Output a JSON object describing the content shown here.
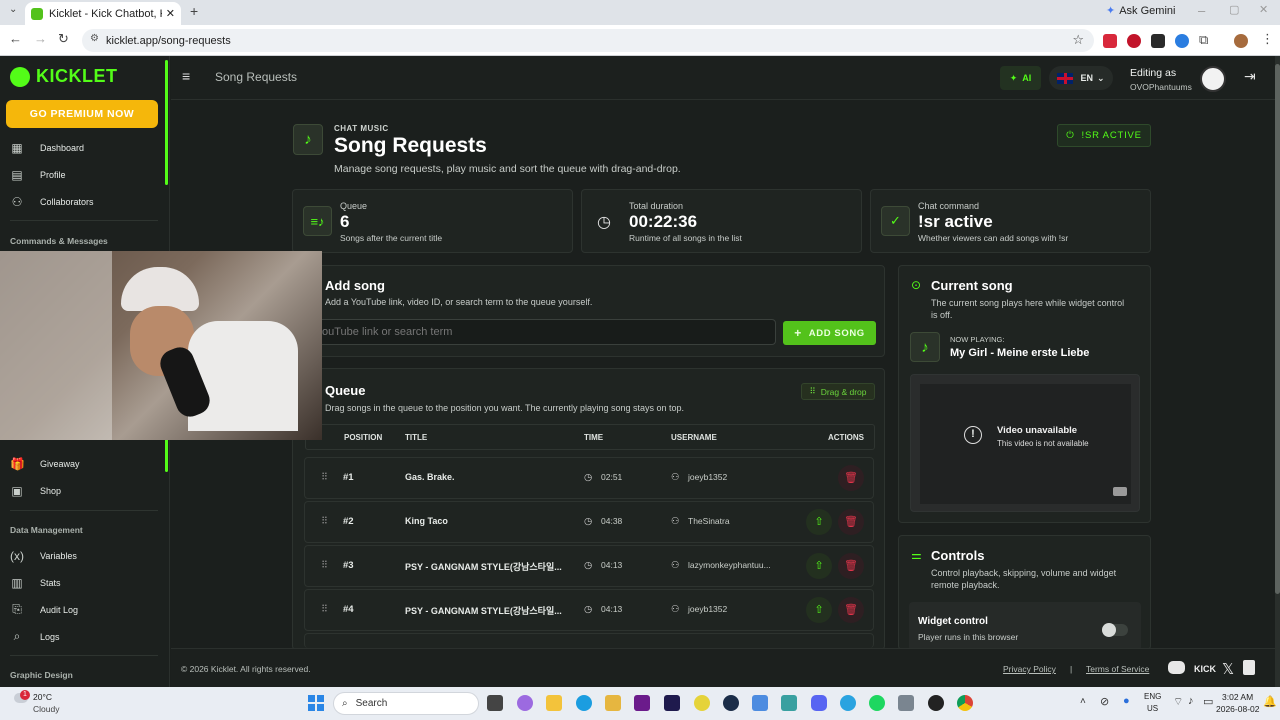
{
  "browser": {
    "tab_title": "Kicklet - Kick Chatbot, Kick Wid",
    "ask_gemini": "Ask Gemini",
    "url": "kicklet.app/song-requests"
  },
  "sidebar": {
    "logo": "KICKLET",
    "premium_button": "GO PREMIUM NOW",
    "items_top": [
      {
        "label": "Dashboard",
        "icon": "dashboard-icon"
      },
      {
        "label": "Profile",
        "icon": "profile-icon"
      },
      {
        "label": "Collaborators",
        "icon": "collaborators-icon"
      }
    ],
    "section_commands": "Commands & Messages",
    "items_mid": [
      {
        "label": "Giveaway",
        "icon": "giveaway-icon"
      },
      {
        "label": "Shop",
        "icon": "shop-icon"
      }
    ],
    "section_data": "Data Management",
    "items_data": [
      {
        "label": "Variables",
        "icon": "variables-icon"
      },
      {
        "label": "Stats",
        "icon": "stats-icon"
      },
      {
        "label": "Audit Log",
        "icon": "audit-log-icon"
      },
      {
        "label": "Logs",
        "icon": "logs-icon"
      }
    ],
    "section_graphic": "Graphic Design"
  },
  "topbar": {
    "title": "Song Requests",
    "ai_label": "AI",
    "lang": "EN",
    "editing_as": "Editing as",
    "username": "OVOPhantuums"
  },
  "header": {
    "kicker": "CHAT MUSIC",
    "title": "Song Requests",
    "subtitle": "Manage song requests, play music and sort the queue with drag-and-drop.",
    "status_badge": "!SR ACTIVE"
  },
  "stats": [
    {
      "label": "Queue",
      "value": "6",
      "sub": "Songs after the current title"
    },
    {
      "label": "Total duration",
      "value": "00:22:36",
      "sub": "Runtime of all songs in the list"
    },
    {
      "label": "Chat command",
      "value": "!sr active",
      "sub": "Whether viewers can add songs with !sr"
    }
  ],
  "add_song": {
    "title": "Add song",
    "subtitle": "Add a YouTube link, video ID, or search term to the queue yourself.",
    "placeholder": "ouTube link or search term",
    "button": "ADD SONG"
  },
  "queue": {
    "title": "Queue",
    "subtitle": "Drag songs in the queue to the position you want. The currently playing song stays on top.",
    "badge": "Drag & drop",
    "columns": [
      "POSITION",
      "TITLE",
      "TIME",
      "USERNAME",
      "ACTIONS"
    ],
    "rows": [
      {
        "pos": "#1",
        "title": "Gas. Brake.",
        "time": "02:51",
        "user": "joeyb1352"
      },
      {
        "pos": "#2",
        "title": "King Taco",
        "time": "04:38",
        "user": "TheSinatra"
      },
      {
        "pos": "#3",
        "title": "PSY - GANGNAM STYLE(강남스타일...",
        "time": "04:13",
        "user": "lazymonkeyphantuu..."
      },
      {
        "pos": "#4",
        "title": "PSY - GANGNAM STYLE(강남스타일...",
        "time": "04:13",
        "user": "joeyb1352"
      }
    ]
  },
  "current_song": {
    "title": "Current song",
    "subtitle": "The current song plays here while widget control is off.",
    "now_playing_label": "NOW PLAYING:",
    "song": "My Girl - Meine erste Liebe",
    "video_title": "Video unavailable",
    "video_sub": "This video is not available"
  },
  "controls": {
    "title": "Controls",
    "subtitle": "Control playback, skipping, volume and widget remote playback.",
    "widget_title": "Widget control",
    "widget_sub": "Player runs in this browser",
    "widget_enabled": false
  },
  "footer": {
    "copyright": "© 2026 Kicklet. All rights reserved.",
    "privacy": "Privacy Policy",
    "sep": "|",
    "terms": "Terms of Service",
    "kick": "KICK"
  },
  "taskbar": {
    "temp": "20°C",
    "weather": "Cloudy",
    "weather_badge": "1",
    "search": "Search",
    "lang1": "ENG",
    "lang2": "US",
    "time": "3:02 AM",
    "date": "2026-08-02"
  },
  "colors": {
    "accent": "#53fc18",
    "premium": "#f5b70b",
    "bg": "#1b1f1d",
    "danger": "#e0344a"
  }
}
